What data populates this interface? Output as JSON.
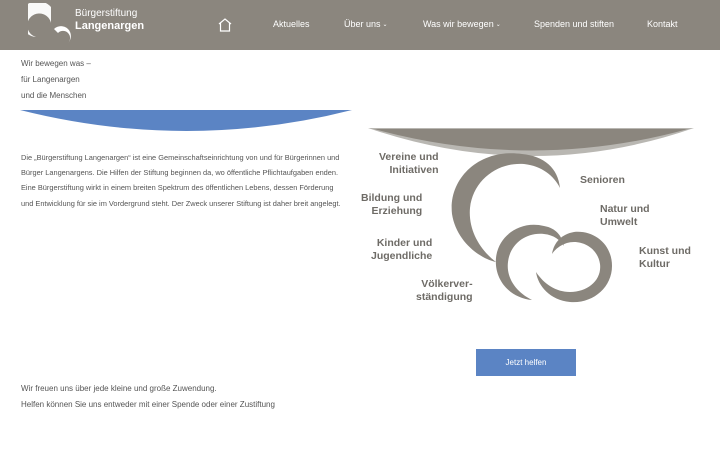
{
  "header": {
    "logo": {
      "line1": "Bürgerstiftung",
      "line2": "Langenargen",
      "icon": "swirl-logo-icon"
    },
    "home_icon": "home-icon",
    "nav": [
      {
        "label": "Aktuelles",
        "has_dropdown": false
      },
      {
        "label": "Über uns",
        "has_dropdown": true
      },
      {
        "label": "Was wir bewegen",
        "has_dropdown": true
      },
      {
        "label": "Spenden und stiften",
        "has_dropdown": false
      },
      {
        "label": "Kontakt",
        "has_dropdown": false
      }
    ],
    "dropdown_caret": "⌄"
  },
  "tagline": {
    "line1": "Wir bewegen was –",
    "line2": "für Langenargen",
    "line3": "und die Menschen"
  },
  "intro": "Die „Bürgerstiftung Langenargen“ ist eine Gemeinschaftseinrichtung von und für Bürgerinnen und Bürger Langenargens. Die Hilfen der Stiftung beginnen da, wo öffentliche Pflichtaufgaben enden. Eine Bürgerstiftung wirkt in einem breiten Spektrum des öffentlichen Lebens, dessen Förderung und Entwicklung für sie im Vordergrund steht. Der Zweck unserer Stiftung ist daher breit angelegt.",
  "graphic": {
    "categories": {
      "vereine": [
        "Vereine und",
        "Initiativen"
      ],
      "bildung": [
        "Bildung und",
        "Erziehung"
      ],
      "kinder": [
        "Kinder und",
        "Jugendliche"
      ],
      "voelker": [
        "Völkerver-",
        "ständigung"
      ],
      "senioren": [
        "Senioren"
      ],
      "natur": [
        "Natur und",
        "Umwelt"
      ],
      "kunst": [
        "Kunst und",
        "Kultur"
      ]
    }
  },
  "cta": {
    "label": "Jetzt helfen"
  },
  "closing": {
    "line1": "Wir freuen uns über jede kleine und große Zuwendung.",
    "line2": "Helfen können Sie uns entweder mit einer Spende oder einer Zustiftung"
  },
  "colors": {
    "header_bg": "#8b867e",
    "accent_blue": "#5b84c4",
    "swirl_grey": "#8b867e",
    "arc_grey": "#b9b7b2"
  }
}
